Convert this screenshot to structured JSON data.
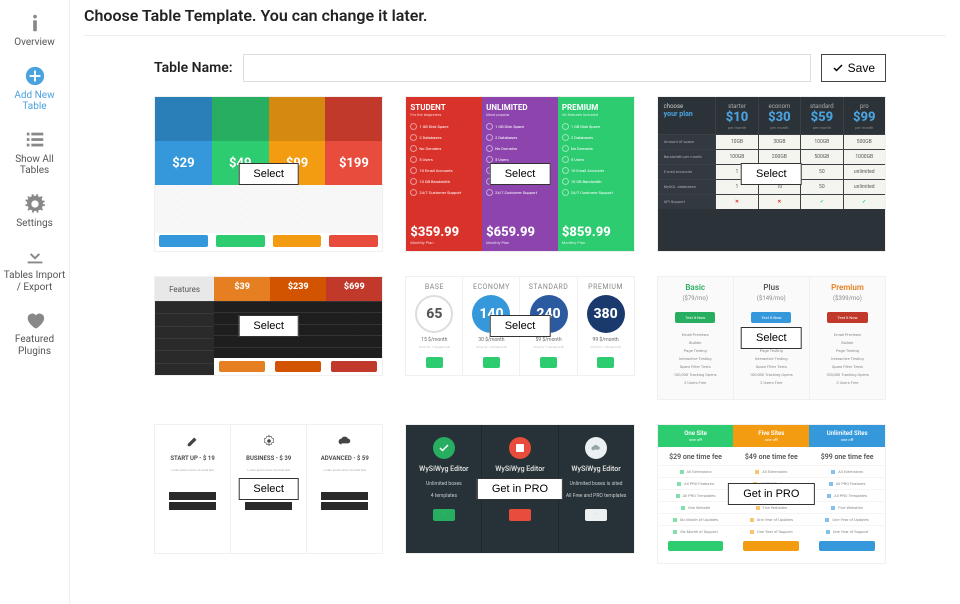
{
  "heading": "Choose Table Template. You can change it later.",
  "sidebar": {
    "items": [
      {
        "label": "Overview"
      },
      {
        "label": "Add New Table"
      },
      {
        "label": "Show All Tables"
      },
      {
        "label": "Settings"
      },
      {
        "label": "Tables Import / Export"
      },
      {
        "label": "Featured Plugins"
      }
    ]
  },
  "form": {
    "name_label": "Table Name:",
    "name_value": "",
    "save_label": "Save"
  },
  "btn": {
    "select": "Select",
    "get_pro": "Get in PRO"
  },
  "templates": {
    "t1": {
      "plans": [
        {
          "price": "$29"
        },
        {
          "price": "$49"
        },
        {
          "price": "$99"
        },
        {
          "price": "$199"
        }
      ]
    },
    "t2": {
      "plans": [
        {
          "name": "STUDENT",
          "price": "$359.99",
          "per": "Monthly Plan"
        },
        {
          "name": "UNLIMITED",
          "price": "$659.99",
          "per": "Monthly Plan"
        },
        {
          "name": "PREMIUM",
          "price": "$859.99",
          "per": "Monthly Plan"
        }
      ],
      "features": [
        "1 GB Disk Space",
        "2 Databases",
        "No Domains",
        "5 Users",
        "10 Email Accounts",
        "10 GB Bandwidth",
        "24/7 Customer Support"
      ]
    },
    "t3": {
      "choose": "choose",
      "your_plan": "your plan",
      "plans": [
        {
          "name": "starter",
          "price": "$10",
          "per": "per month"
        },
        {
          "name": "econom",
          "price": "$30",
          "per": "per month"
        },
        {
          "name": "standard",
          "price": "$59",
          "per": "per month"
        },
        {
          "name": "pro",
          "price": "$99",
          "per": "per month"
        }
      ],
      "rows": [
        "Amount of space",
        "Bandwidth per month",
        "E-mail accounts",
        "MySQL databases",
        "API Support"
      ],
      "vals": [
        [
          "10GB",
          "30GB",
          "100GB",
          "500GB"
        ],
        [
          "100GB",
          "200GB",
          "500GB",
          "1000GB"
        ],
        [
          "1",
          "10",
          "50",
          "unlimited"
        ],
        [
          "1",
          "10",
          "50",
          "unlimited"
        ],
        [
          "x",
          "x",
          "t",
          "t"
        ]
      ]
    },
    "t4": {
      "features_label": "Features",
      "plans": [
        {
          "price": "$39"
        },
        {
          "price": "$239"
        },
        {
          "price": "$699"
        }
      ]
    },
    "t5": {
      "plans": [
        {
          "name": "BASE",
          "num": "65",
          "meta": "15 $/month"
        },
        {
          "name": "ECONOMY",
          "num": "140",
          "meta": "30 $/month"
        },
        {
          "name": "STANDARD",
          "num": "240",
          "meta": "59 $/month"
        },
        {
          "name": "PREMIUM",
          "num": "380",
          "meta": "99 $/month"
        }
      ]
    },
    "t6": {
      "plans": [
        {
          "name": "Basic",
          "price": "($79/mo)"
        },
        {
          "name": "Plus",
          "price": "($149/mo)"
        },
        {
          "name": "Premium",
          "price": "($399/mo)"
        }
      ],
      "features": [
        "Email Previews",
        "Builder",
        "Page Testing",
        "Interactive Testing",
        "Spam Filter Tests",
        "100,000 Tracking Opens",
        "2 Users Free"
      ]
    },
    "t7": {
      "plans": [
        {
          "name": "START UP - $ 19"
        },
        {
          "name": "BUSINESS - $ 39"
        },
        {
          "name": "ADVANCED - $ 59"
        }
      ]
    },
    "t8": {
      "plans": [
        {
          "name": "WySiWyg Editor",
          "f1": "Unlimited boxes",
          "f2": "4 templates"
        },
        {
          "name": "WySiWyg Editor",
          "f1": "Unlimited boxes is sited",
          "f2": "All Free and PRO templates"
        },
        {
          "name": "WySiWyg Editor",
          "f1": "Unlimited boxes is sited",
          "f2": "All Free and PRO templates"
        }
      ]
    },
    "t9": {
      "plans": [
        {
          "name": "One Site",
          "price": "$29 one time fee"
        },
        {
          "name": "Five Sites",
          "price": "$49 one time fee"
        },
        {
          "name": "Unlimited Sites",
          "price": "$99 one time fee"
        }
      ],
      "features": [
        "All Extensions",
        "All PRO Features",
        "All PRO Templates",
        "One Website",
        "Six Month of Updates",
        "Six Month of Support"
      ]
    }
  }
}
